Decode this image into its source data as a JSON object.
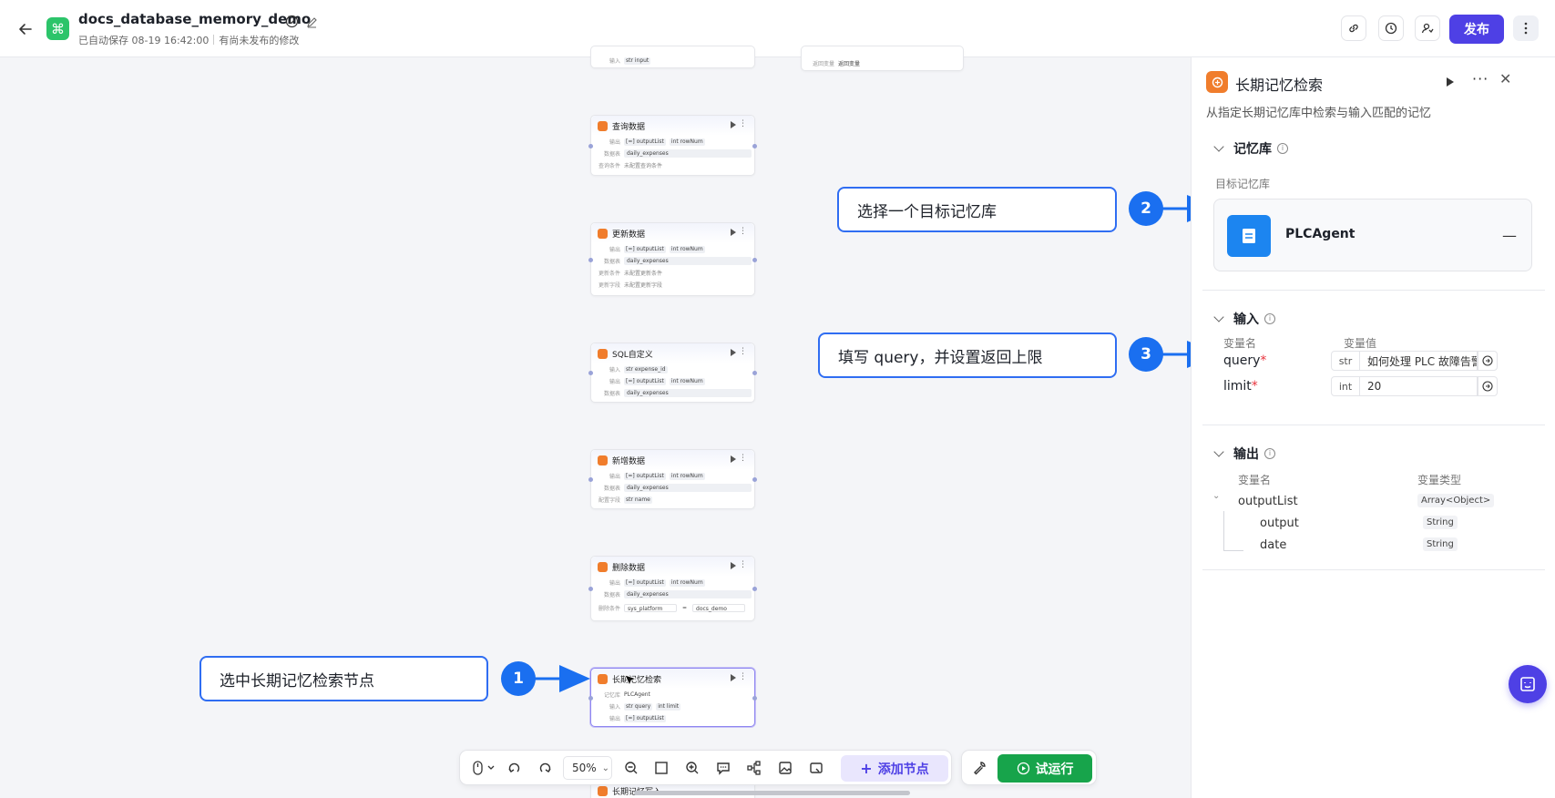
{
  "header": {
    "title": "docs_database_memory_demo",
    "autosave": "已自动保存 08-19 16:42:00",
    "unpublished": "有尚未发布的修改",
    "publish_label": "发布"
  },
  "canvas": {
    "top_fragments": {
      "left_text": "输入",
      "left_tag": "str input",
      "right_label": "返回变量",
      "right_value": "返回变量"
    },
    "nodes": [
      {
        "title": "查询数据",
        "rows": [
          {
            "label": "输出",
            "tags": [
              "[=] outputList",
              "int rowNum"
            ]
          },
          {
            "label": "数据表",
            "field": "daily_expenses"
          },
          {
            "label": "查询条件",
            "text": "未配置查询条件"
          }
        ]
      },
      {
        "title": "更新数据",
        "rows": [
          {
            "label": "输出",
            "tags": [
              "[=] outputList",
              "int rowNum"
            ]
          },
          {
            "label": "数据表",
            "field": "daily_expenses"
          },
          {
            "label": "更新条件",
            "text": "未配置更新条件"
          },
          {
            "label": "更新字段",
            "text": "未配置更新字段"
          }
        ]
      },
      {
        "title": "SQL自定义",
        "rows": [
          {
            "label": "输入",
            "tags": [
              "str expense_id"
            ]
          },
          {
            "label": "输出",
            "tags": [
              "[=] outputList",
              "int rowNum"
            ]
          },
          {
            "label": "数据表",
            "field": "daily_expenses"
          }
        ]
      },
      {
        "title": "新增数据",
        "rows": [
          {
            "label": "输出",
            "tags": [
              "[=] outputList",
              "int rowNum"
            ]
          },
          {
            "label": "数据表",
            "field": "daily_expenses"
          },
          {
            "label": "配置字段",
            "tags": [
              "str name"
            ]
          }
        ]
      },
      {
        "title": "删除数据",
        "rows": [
          {
            "label": "输出",
            "tags": [
              "[=] outputList",
              "int rowNum"
            ]
          },
          {
            "label": "数据表",
            "field": "daily_expenses"
          },
          {
            "label": "删除条件",
            "cond": [
              "sys_platform",
              "=",
              "docs_demo"
            ]
          }
        ]
      },
      {
        "title": "长期记忆检索",
        "rows": [
          {
            "label": "记忆库",
            "text": "PLCAgent"
          },
          {
            "label": "输入",
            "tags": [
              "str query",
              "int limit"
            ]
          },
          {
            "label": "输出",
            "tags": [
              "[=] outputList"
            ]
          }
        ]
      }
    ],
    "bottom_fragment": "长期记忆写入"
  },
  "callouts": [
    {
      "step": "1",
      "text": "选中长期记忆检索节点"
    },
    {
      "step": "2",
      "text": "选择一个目标记忆库"
    },
    {
      "step": "3",
      "text": "填写 query，并设置返回上限"
    }
  ],
  "toolbar": {
    "zoom": "50%",
    "add_node_label": "添加节点",
    "run_label": "试运行"
  },
  "panel": {
    "title": "长期记忆检索",
    "description": "从指定长期记忆库中检索与输入匹配的记忆",
    "memory_section": "记忆库",
    "memory_sublabel": "目标记忆库",
    "memory_selected": "PLCAgent",
    "input_section": "输入",
    "input_col_name": "变量名",
    "input_col_value": "变量值",
    "inputs": [
      {
        "name": "query",
        "type": "str",
        "value": "如何处理 PLC 故障告警"
      },
      {
        "name": "limit",
        "type": "int",
        "value": "20"
      }
    ],
    "output_section": "输出",
    "output_col_name": "变量名",
    "output_col_type": "变量类型",
    "outputs": [
      {
        "name": "outputList",
        "type": "Array<Object>"
      },
      {
        "name": "output",
        "type": "String"
      },
      {
        "name": "date",
        "type": "String"
      }
    ]
  },
  "colors": {
    "accent": "#4e40e5",
    "callout": "#2f6df2",
    "run": "#17a44b",
    "node_icon": "#f07d2c"
  }
}
